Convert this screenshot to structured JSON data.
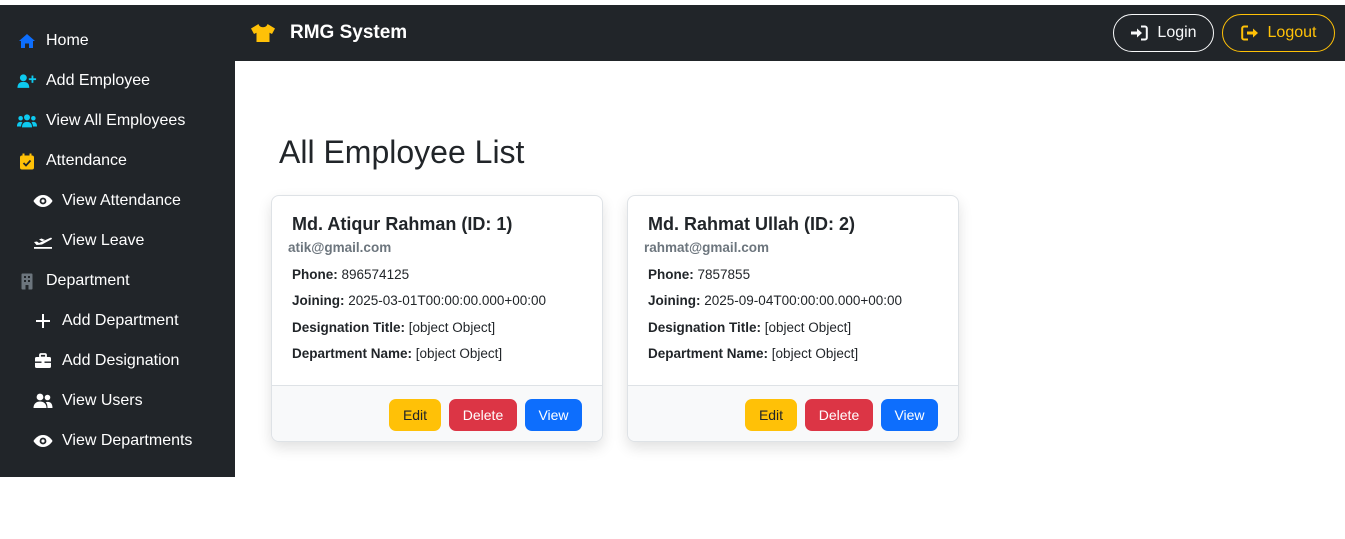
{
  "colors": {
    "dark_bg": "#212529",
    "icon_blue": "#0d6efd",
    "icon_teal": "#0dcaf0",
    "icon_yellow": "#ffc107",
    "icon_gray": "#6c757d",
    "btn_edit": "#ffc107",
    "btn_delete": "#dc3545",
    "btn_view": "#0d6efd"
  },
  "navbar": {
    "brand": "RMG System",
    "brand_icon": "shirt-icon",
    "login_label": "Login",
    "logout_label": "Logout"
  },
  "sidebar": {
    "items": [
      {
        "label": "Home",
        "icon": "home-icon"
      },
      {
        "label": "Add Employee",
        "icon": "user-plus-icon"
      },
      {
        "label": "View All Employees",
        "icon": "users-icon"
      },
      {
        "label": "Attendance",
        "icon": "calendar-check-icon"
      },
      {
        "label": "View Attendance",
        "icon": "eye-icon"
      },
      {
        "label": "View Leave",
        "icon": "plane-departure-icon"
      },
      {
        "label": "Department",
        "icon": "building-icon"
      },
      {
        "label": "Add Department",
        "icon": "plus-icon"
      },
      {
        "label": "Add Designation",
        "icon": "briefcase-icon"
      },
      {
        "label": "View Users",
        "icon": "user-group-icon"
      },
      {
        "label": "View Departments",
        "icon": "eye-icon"
      }
    ]
  },
  "main": {
    "title": "All Employee List",
    "labels": {
      "phone": "Phone:",
      "joining": "Joining:",
      "designation": "Designation Title:",
      "department": "Department Name:"
    },
    "buttons": {
      "edit": "Edit",
      "delete": "Delete",
      "view": "View"
    },
    "employees": [
      {
        "name": "Md. Atiqur Rahman (ID: 1)",
        "email": "atik@gmail.com",
        "phone": "896574125",
        "joining": "2025-03-01T00:00:00.000+00:00",
        "designation": "[object Object]",
        "department": "[object Object]"
      },
      {
        "name": "Md. Rahmat Ullah (ID: 2)",
        "email": "rahmat@gmail.com",
        "phone": "7857855",
        "joining": "2025-09-04T00:00:00.000+00:00",
        "designation": "[object Object]",
        "department": "[object Object]"
      }
    ]
  }
}
